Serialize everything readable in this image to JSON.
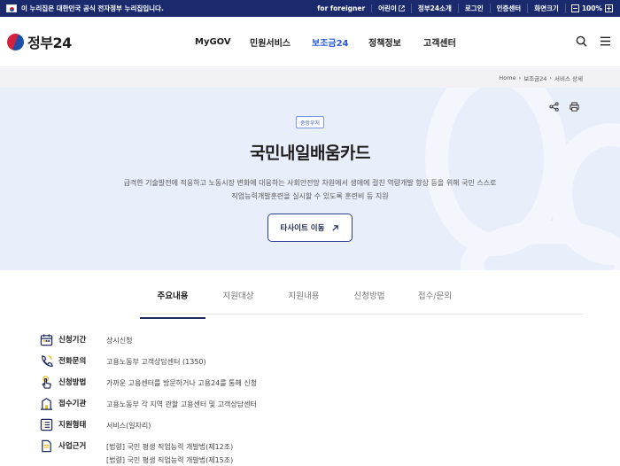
{
  "govbar": {
    "notice": "이 누리집은 대한민국 공식 전자정부 누리집입니다.",
    "links": [
      "for foreigner",
      "어린이",
      "정부24소개",
      "로그인",
      "인증센터",
      "화면크기"
    ],
    "zoom_level": "100%"
  },
  "header": {
    "logo_text": "정부24",
    "nav": [
      "MyGOV",
      "민원서비스",
      "보조금24",
      "정책정보",
      "고객센터"
    ],
    "active_nav": "보조금24"
  },
  "breadcrumb": [
    "Home",
    "보조금24",
    "서비스 상세"
  ],
  "hero": {
    "badge": "중앙부처",
    "title": "국민내일배움카드",
    "desc_line1": "급격한 기술발전에 적응하고 노동시장 변화에 대응하는 사회안전망 차원에서 생애에 걸친 역량개발 향상 등을 위해 국민 스스로",
    "desc_line2": "직업능력개발훈련을 실시할 수 있도록 훈련비 등 지원",
    "button_label": "타사이트 이동"
  },
  "tabs": [
    "주요내용",
    "지원대상",
    "지원내용",
    "신청방법",
    "접수/문의"
  ],
  "rows": [
    {
      "label": "신청기간",
      "values": [
        "상시신청"
      ],
      "icon": "calendar-icon"
    },
    {
      "label": "전화문의",
      "values": [
        "고용노동부 고객상담센터 (1350)"
      ],
      "icon": "phone-icon"
    },
    {
      "label": "신청방법",
      "values": [
        "가까운 고용센터를 방문하거나 고용24를 통해 신청"
      ],
      "icon": "hand-pointer-icon"
    },
    {
      "label": "접수기관",
      "values": [
        "고용노동부 각 지역 관할 고용센터 및 고객상담센터"
      ],
      "icon": "building-icon"
    },
    {
      "label": "지원형태",
      "values": [
        "서비스(일자리)"
      ],
      "icon": "list-icon"
    },
    {
      "label": "사업근거",
      "values": [
        "[법령] 국민 평생 직업능력 개발법(제12조)",
        "[법령] 국민 평생 직업능력 개발법(제15조)"
      ],
      "icon": "document-icon"
    }
  ],
  "colors": {
    "navy": "#1a2a6c",
    "accent": "#2a5ad7",
    "hero_bg": "#e9eefb"
  }
}
